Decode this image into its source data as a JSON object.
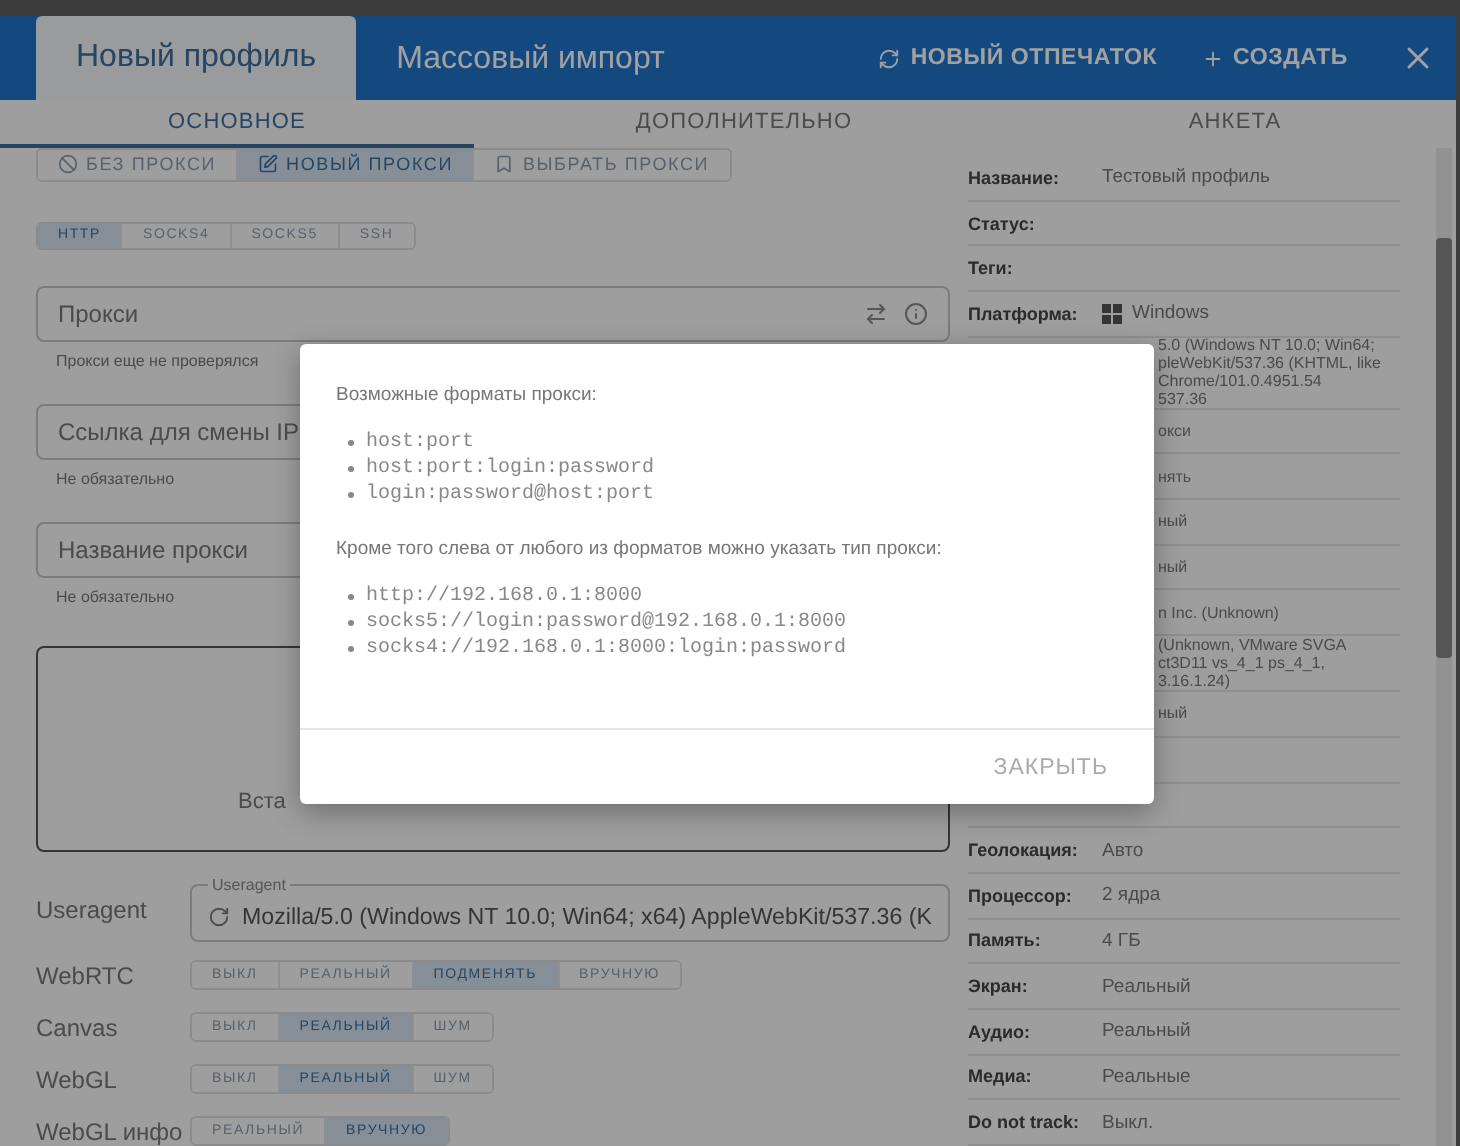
{
  "header": {
    "tabs": [
      {
        "label": "Новый профиль",
        "selected": true
      },
      {
        "label": "Массовый импорт",
        "selected": false
      }
    ],
    "actions": [
      {
        "kind": "refresh",
        "label": "НОВЫЙ ОТПЕЧАТОК"
      },
      {
        "kind": "add",
        "label": "СОЗДАТЬ"
      }
    ]
  },
  "section_tabs": [
    {
      "label": "ОСНОВНОЕ",
      "selected": true
    },
    {
      "label": "ДОПОЛНИТЕЛЬНО",
      "selected": false
    },
    {
      "label": "АНКЕТА",
      "selected": false
    }
  ],
  "proxy_modes": [
    {
      "kind": "none",
      "label": "БЕЗ ПРОКСИ",
      "selected": false
    },
    {
      "kind": "new",
      "label": "НОВЫЙ ПРОКСИ",
      "selected": true
    },
    {
      "kind": "pick",
      "label": "ВЫБРАТЬ ПРОКСИ",
      "selected": false
    }
  ],
  "protocols": [
    {
      "label": "HTTP",
      "selected": true
    },
    {
      "label": "SOCKS4",
      "selected": false
    },
    {
      "label": "SOCKS5",
      "selected": false
    },
    {
      "label": "SSH",
      "selected": false
    }
  ],
  "fields": [
    {
      "kind": "proxy",
      "placeholder": "Прокси",
      "helper": "Прокси еще не проверялся"
    },
    {
      "kind": "plain",
      "placeholder": "Ссылка для смены IP",
      "helper": "Не обязательно"
    },
    {
      "kind": "plain",
      "placeholder": "Название прокси",
      "helper": "Не обязательно"
    }
  ],
  "textarea": {
    "placeholder": "Вста"
  },
  "useragent": {
    "label": "Useragent",
    "field_label": "Useragent",
    "value": "Mozilla/5.0 (Windows NT 10.0; Win64; x64) AppleWebKit/537.36 (K"
  },
  "options": [
    {
      "label": "WebRTC",
      "choices": [
        {
          "label": "ВЫКЛ",
          "selected": false
        },
        {
          "label": "РЕАЛЬНЫЙ",
          "selected": false
        },
        {
          "label": "ПОДМЕНЯТЬ",
          "selected": true
        },
        {
          "label": "ВРУЧНУЮ",
          "selected": false
        }
      ]
    },
    {
      "label": "Canvas",
      "choices": [
        {
          "label": "ВЫКЛ",
          "selected": false
        },
        {
          "label": "РЕАЛЬНЫЙ",
          "selected": true
        },
        {
          "label": "ШУМ",
          "selected": false
        }
      ]
    },
    {
      "label": "WebGL",
      "choices": [
        {
          "label": "ВЫКЛ",
          "selected": false
        },
        {
          "label": "РЕАЛЬНЫЙ",
          "selected": true
        },
        {
          "label": "ШУМ",
          "selected": false
        }
      ]
    },
    {
      "label": "WebGL инфо",
      "choices": [
        {
          "label": "РЕАЛЬНЫЙ",
          "selected": false
        },
        {
          "label": "ВРУЧНУЮ",
          "selected": true
        }
      ]
    }
  ],
  "summary": [
    {
      "kind": "pair",
      "label": "Название:",
      "value": "Тестовый профиль"
    },
    {
      "kind": "pair",
      "label": "Статус:"
    },
    {
      "kind": "pair",
      "label": "Теги:"
    },
    {
      "kind": "platform",
      "label": "Платформа:",
      "value": "Windows"
    },
    {
      "kind": "covered",
      "lines": [
        "5.0 (Windows NT 10.0; Win64;",
        "pleWebKit/537.36 (KHTML, like",
        "Chrome/101.0.4951.54",
        "537.36"
      ]
    },
    {
      "kind": "covered",
      "lines": [
        "окси"
      ]
    },
    {
      "kind": "covered",
      "lines": [
        "нять"
      ]
    },
    {
      "kind": "covered",
      "lines": [
        "ный"
      ]
    },
    {
      "kind": "covered",
      "lines": [
        "ный"
      ]
    },
    {
      "kind": "covered",
      "lines": [
        "n Inc. (Unknown)"
      ]
    },
    {
      "kind": "covered",
      "lines": [
        "(Unknown, VMware SVGA",
        "ct3D11 vs_4_1 ps_4_1,",
        "3.16.1.24)"
      ]
    },
    {
      "kind": "covered",
      "lines": [
        "ный"
      ]
    },
    {
      "kind": "blank"
    },
    {
      "kind": "blank"
    },
    {
      "kind": "pair",
      "label": "Геолокация:",
      "value": "Авто"
    },
    {
      "kind": "pair",
      "label": "Процессор:",
      "value": "2 ядра"
    },
    {
      "kind": "pair",
      "label": "Память:",
      "value": "4 ГБ"
    },
    {
      "kind": "pair",
      "label": "Экран:",
      "value": "Реальный"
    },
    {
      "kind": "pair",
      "label": "Аудио:",
      "value": "Реальный"
    },
    {
      "kind": "pair",
      "label": "Медиа:",
      "value": "Реальные"
    },
    {
      "kind": "pair",
      "label": "Do not track:",
      "value": "Выкл."
    }
  ],
  "modal": {
    "intro": "Возможные форматы прокси:",
    "formats": [
      "host:port",
      "host:port:login:password",
      "login:password@host:port"
    ],
    "note": "Кроме того слева от любого из форматов можно указать тип прокси:",
    "examples": [
      "http://192.168.0.1:8000",
      "socks5://login:password@192.168.0.1:8000",
      "socks4://192.168.0.1:8000:login:password"
    ],
    "button": "ЗАКРЫТЬ"
  }
}
